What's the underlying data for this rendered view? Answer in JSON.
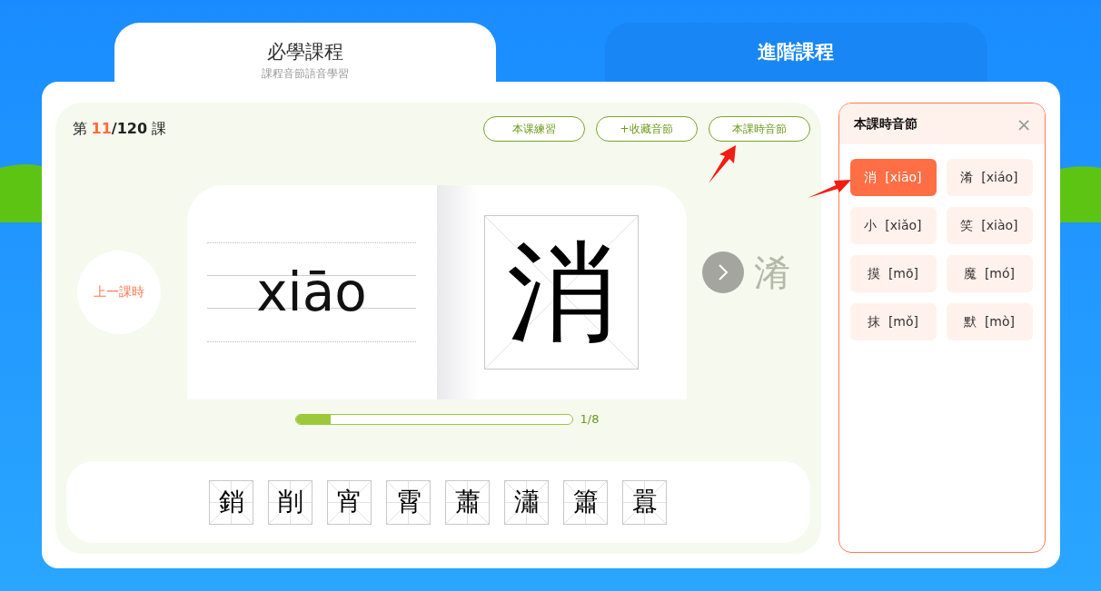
{
  "tabs": [
    {
      "title": "必學課程",
      "subtitle": "課程音節語音學習",
      "selected": true
    },
    {
      "title": "進階課程",
      "selected": false
    }
  ],
  "lesson": {
    "prefix": "第",
    "current": "11",
    "total": "/120",
    "suffix": "課"
  },
  "actions": [
    "本课練習",
    "+收藏音節",
    "本課時音節"
  ],
  "card": {
    "pinyin": "xiāo",
    "character": "消",
    "previous": "上一課時",
    "next_preview": "淆"
  },
  "progress": {
    "level": 0.125,
    "reading": "1/8"
  },
  "words": [
    "銷",
    "削",
    "宵",
    "霄",
    "蕭",
    "瀟",
    "簫",
    "囂"
  ],
  "panel": {
    "title": "本課時音節",
    "close": "×",
    "syllables": [
      {
        "char": "消",
        "pinyin": "[xiāo]",
        "selected": true
      },
      {
        "char": "淆",
        "pinyin": "[xiáo]",
        "selected": false
      },
      {
        "char": "小",
        "pinyin": "[xiǎo]",
        "selected": false
      },
      {
        "char": "笑",
        "pinyin": "[xiào]",
        "selected": false
      },
      {
        "char": "摸",
        "pinyin": "[mō]",
        "selected": false
      },
      {
        "char": "魔",
        "pinyin": "[mó]",
        "selected": false
      },
      {
        "char": "抹",
        "pinyin": "[mǒ]",
        "selected": false
      },
      {
        "char": "默",
        "pinyin": "[mò]",
        "selected": false
      }
    ]
  }
}
